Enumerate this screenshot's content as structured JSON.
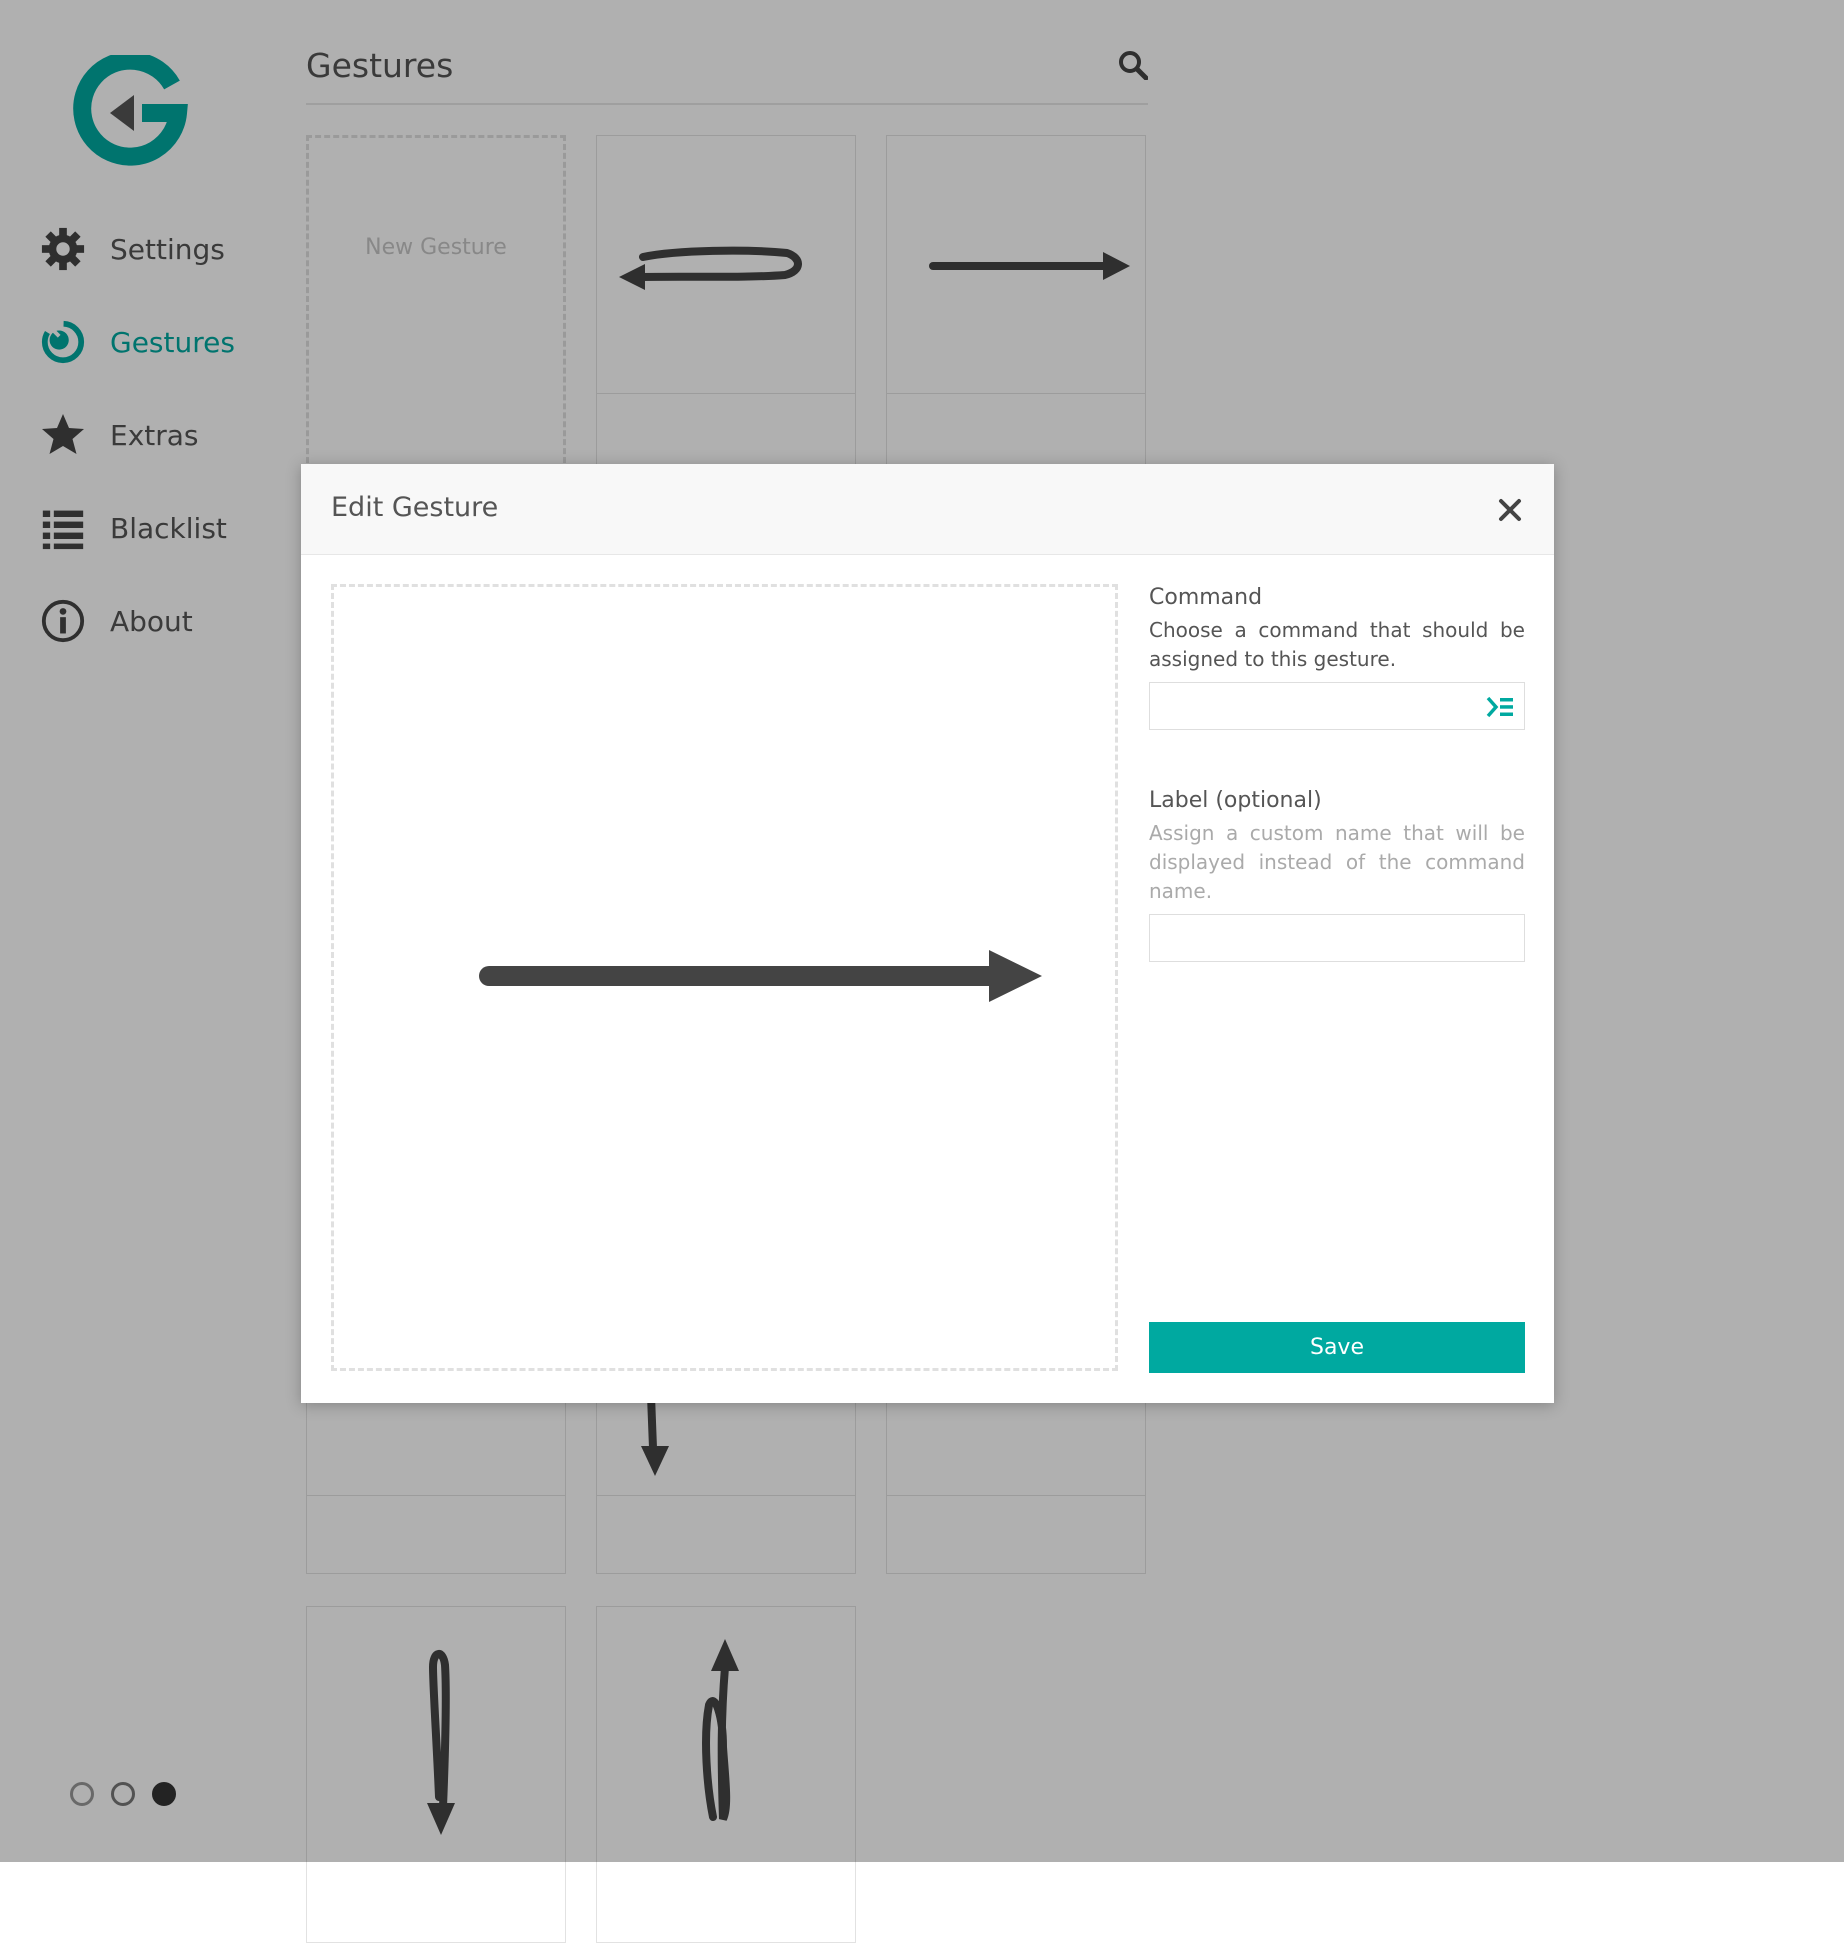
{
  "colors": {
    "accent": "#00a9a0",
    "text": "#555555",
    "icon": "#333333"
  },
  "sidebar": {
    "logo_icon": "gesturefy-logo-icon",
    "items": [
      {
        "label": "Settings",
        "icon": "gear-icon",
        "active": false
      },
      {
        "label": "Gestures",
        "icon": "gesture-icon",
        "active": true
      },
      {
        "label": "Extras",
        "icon": "star-icon",
        "active": false
      },
      {
        "label": "Blacklist",
        "icon": "list-icon",
        "active": false
      },
      {
        "label": "About",
        "icon": "info-icon",
        "active": false
      }
    ],
    "theme_dots": [
      {
        "name": "light-theme",
        "color": "#ffffff"
      },
      {
        "name": "highlighted-theme",
        "color": "#ffffff"
      },
      {
        "name": "dark-theme",
        "color": "#333333"
      }
    ]
  },
  "main": {
    "title": "Gestures",
    "search_icon": "search-icon",
    "new_gesture_label": "New Gesture"
  },
  "modal": {
    "title": "Edit Gesture",
    "close_icon": "close-icon",
    "command": {
      "title": "Command",
      "description": "Choose a command that should be assigned to this gesture.",
      "value": "",
      "icon": "command-select-icon"
    },
    "label": {
      "title": "Label (optional)",
      "description": "Assign a custom name that will be displayed instead of the command name.",
      "value": ""
    },
    "save_label": "Save"
  }
}
